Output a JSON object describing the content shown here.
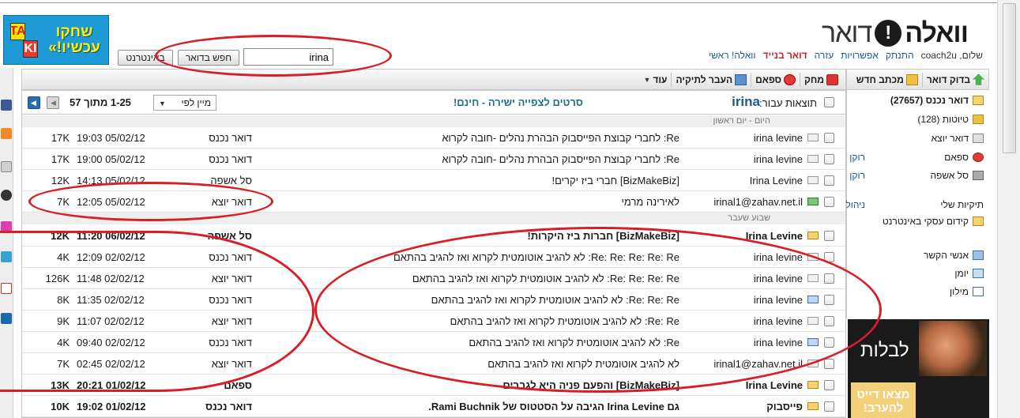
{
  "header": {
    "logo_word": "וואלה",
    "logo_mail": "דואר",
    "links": [
      "וואלה! ראשי",
      "דואר בנייד",
      "עזרה",
      "אפשרויות",
      "התנתק"
    ],
    "user": "שלום, coach2u",
    "ad_text": "שחקו עכשיו!»",
    "ad_blocks": [
      "TA",
      "KI"
    ]
  },
  "search": {
    "value": "irina",
    "mail_button": "חפש בדואר",
    "web_button": "באינטרנט"
  },
  "toolbar_left": {
    "check": "בדוק דואר",
    "compose": "מכתב חדש"
  },
  "toolbar_main": {
    "delete": "מחק",
    "spam": "ספאם",
    "move": "העבר לתיקיה",
    "more": "עוד"
  },
  "folders": [
    {
      "name": "דואר נכנס (27657)",
      "bold": true
    },
    {
      "name": "טיוטות (128)"
    },
    {
      "name": "דואר יוצא"
    },
    {
      "name": "ספאם",
      "link": "רוקן"
    },
    {
      "name": "סל אשפה",
      "link": "רוקן"
    }
  ],
  "my_folders": {
    "label": "תיקיות שלי",
    "manage": "ניהול תיקיות",
    "items": [
      "קידום עסקי באינטרנט"
    ]
  },
  "tools": [
    "אנשי הקשר",
    "יומן",
    "מילון"
  ],
  "ad_side": {
    "text": "לבלות",
    "cta": "מצאו דייט להערב!"
  },
  "results": {
    "label": "תוצאות עבור:",
    "term": "irina",
    "promo": "סרטים לצפייה ישירה - חינם!",
    "sort": "מיין לפי",
    "range": "1-25 מתוך 57"
  },
  "groups": {
    "today": "היום - יום ראשון",
    "last_week": "שבוע שעבר"
  },
  "rows_today": [
    {
      "from": "irina levine",
      "subject": "Re: לחברי קבוצת הפייסבוק הבהרת נהלים -חובה לקרוא",
      "folder": "דואר נכנס",
      "date": "19:03 05/02/12",
      "size": "17K",
      "icon": "read"
    },
    {
      "from": "irina levine",
      "subject": "Re: לחברי קבוצת הפייסבוק הבהרת נהלים -חובה לקרוא",
      "folder": "דואר נכנס",
      "date": "19:00 05/02/12",
      "size": "17K",
      "icon": "read"
    },
    {
      "from": "Irina Levine",
      "subject": "[BizMakeBiz] חברי ביז יקרים!",
      "folder": "סל אשפה",
      "date": "14:13 05/02/12",
      "size": "12K",
      "icon": "read"
    },
    {
      "from": "irinal1@zahav.net.il",
      "subject": "לאירינה מרמי",
      "folder": "דואר יוצא",
      "date": "12:05 05/02/12",
      "size": "7K",
      "icon": "fwd"
    }
  ],
  "rows_week": [
    {
      "from": "Irina Levine",
      "subject": "[BizMakeBiz] חברות ביז היקרות!",
      "folder": "סל אשפה",
      "date": "11:20 06/02/12",
      "size": "12K",
      "icon": "unread",
      "unread": true
    },
    {
      "from": "irina levine",
      "subject": "Re: Re: Re: Re: Re: לא להגיב אוטומטית לקרוא ואז להגיב בהתאם",
      "folder": "דואר נכנס",
      "date": "12:09 02/02/12",
      "size": "4K",
      "icon": "read"
    },
    {
      "from": "irina levine",
      "subject": "Re: Re: Re: Re: לא להגיב אוטומטית לקרוא ואז להגיב בהתאם",
      "folder": "דואר יוצא",
      "date": "11:48 02/02/12",
      "size": "126K",
      "icon": "read"
    },
    {
      "from": "irina levine",
      "subject": "Re: Re: Re: לא להגיב אוטומטית לקרוא ואז להגיב בהתאם",
      "folder": "דואר נכנס",
      "date": "11:35 02/02/12",
      "size": "8K",
      "icon": "reply"
    },
    {
      "from": "irina levine",
      "subject": "Re: Re: לא להגיב אוטומטית לקרוא ואז להגיב בהתאם",
      "folder": "דואר יוצא",
      "date": "11:07 02/02/12",
      "size": "9K",
      "icon": "read"
    },
    {
      "from": "irina levine",
      "subject": "Re: לא להגיב אוטומטית לקרוא ואז להגיב בהתאם",
      "folder": "דואר נכנס",
      "date": "09:40 02/02/12",
      "size": "4K",
      "icon": "reply"
    },
    {
      "from": "irinal1@zahav.net.il",
      "subject": "לא להגיב אוטומטית לקרוא ואז להגיב בהתאם",
      "folder": "דואר יוצא",
      "date": "02:45 02/02/12",
      "size": "7K",
      "icon": "read"
    },
    {
      "from": "Irina Levine",
      "subject": "[BizMakeBiz] והפעם פניה היא לגברים",
      "folder": "ספאם",
      "date": "20:21 01/02/12",
      "size": "13K",
      "icon": "unread",
      "unread": true
    },
    {
      "from": "פייסבוק",
      "subject": "גם Irina Levine הגיבה על הסטטוס של Rami Buchnik.",
      "folder": "דואר נכנס",
      "date": "19:02 01/02/12",
      "size": "10K",
      "icon": "unread",
      "unread": true
    }
  ],
  "colors": {
    "link": "#1a5a96",
    "annotation": "#d61f26",
    "promo": "#1d6f8a"
  }
}
